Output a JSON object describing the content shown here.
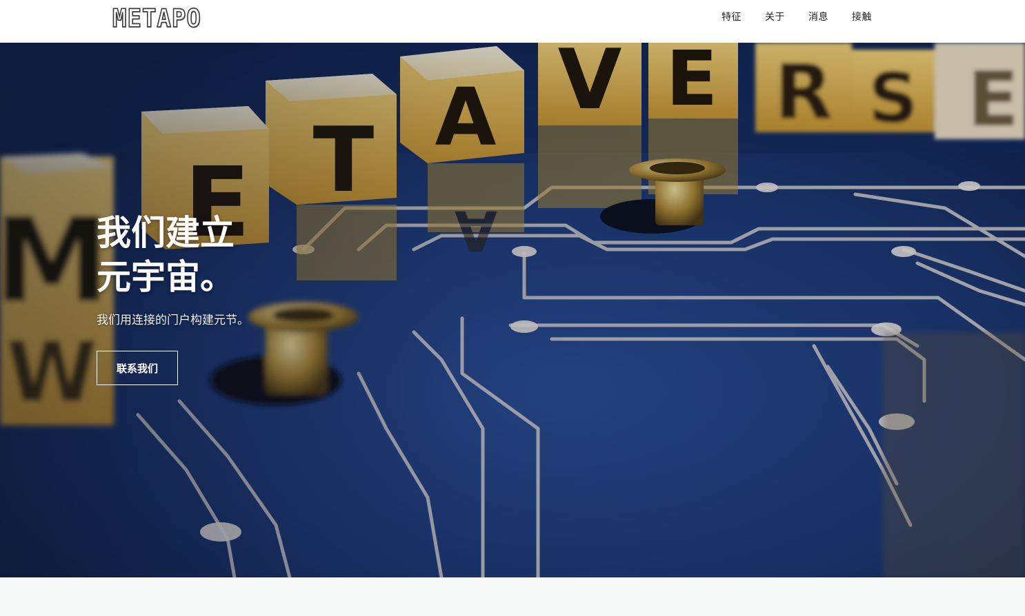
{
  "header": {
    "logo_text": "METAPO",
    "nav": [
      {
        "label": "特征"
      },
      {
        "label": "关于"
      },
      {
        "label": "消息"
      },
      {
        "label": "接触"
      }
    ]
  },
  "hero": {
    "title_line1": "我们建立",
    "title_line2": "元宇宙。",
    "subtitle": "我们用连接的门户构建元节。",
    "button_label": "联系我们",
    "image_blocks": [
      "M",
      "E",
      "T",
      "A",
      "V",
      "E",
      "R",
      "S",
      "E"
    ]
  },
  "colors": {
    "header_bg": "#ffffff",
    "hero_board": "#1b3a7a",
    "block_wood": "#e2b84a",
    "text_light": "#ffffff",
    "page_bg": "#f7f8f8"
  }
}
